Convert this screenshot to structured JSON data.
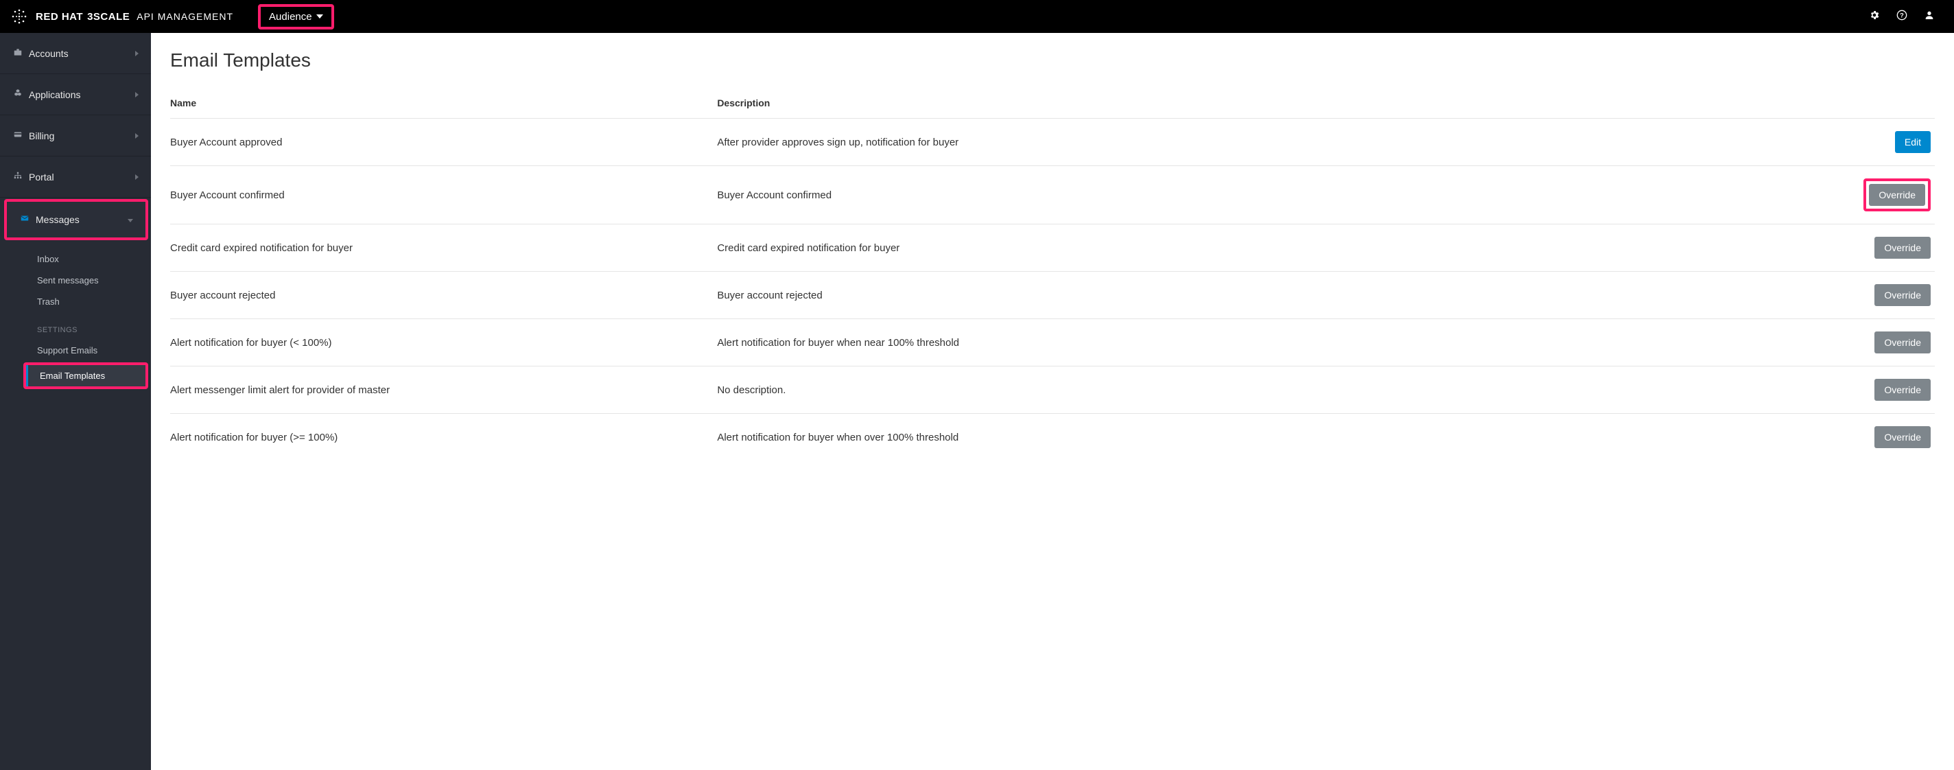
{
  "header": {
    "brand_strong": "RED HAT",
    "brand_strong2": "3SCALE",
    "product": "API MANAGEMENT",
    "context_dropdown": "Audience"
  },
  "sidebar": {
    "items": [
      {
        "icon": "briefcase",
        "label": "Accounts"
      },
      {
        "icon": "cubes",
        "label": "Applications"
      },
      {
        "icon": "card",
        "label": "Billing"
      },
      {
        "icon": "sitemap",
        "label": "Portal"
      },
      {
        "icon": "envelope",
        "label": "Messages"
      }
    ],
    "messages_sub": [
      {
        "label": "Inbox"
      },
      {
        "label": "Sent messages"
      },
      {
        "label": "Trash"
      }
    ],
    "settings_heading": "Settings",
    "settings_sub": [
      {
        "label": "Support Emails"
      },
      {
        "label": "Email Templates",
        "active": true
      }
    ]
  },
  "main": {
    "title": "Email Templates",
    "columns": {
      "name": "Name",
      "description": "Description"
    },
    "rows": [
      {
        "name": "Buyer Account approved",
        "description": "After provider approves sign up, notification for buyer",
        "action": "Edit",
        "action_style": "primary"
      },
      {
        "name": "Buyer Account confirmed",
        "description": "Buyer Account confirmed",
        "action": "Override",
        "action_style": "default",
        "highlighted": true
      },
      {
        "name": "Credit card expired notification for buyer",
        "description": "Credit card expired notification for buyer",
        "action": "Override",
        "action_style": "default"
      },
      {
        "name": "Buyer account rejected",
        "description": "Buyer account rejected",
        "action": "Override",
        "action_style": "default"
      },
      {
        "name": "Alert notification for buyer (< 100%)",
        "description": "Alert notification for buyer when near 100% threshold",
        "action": "Override",
        "action_style": "default"
      },
      {
        "name": "Alert messenger limit alert for provider of master",
        "description": "No description.",
        "action": "Override",
        "action_style": "default"
      },
      {
        "name": "Alert notification for buyer (>= 100%)",
        "description": "Alert notification for buyer when over 100% threshold",
        "action": "Override",
        "action_style": "default"
      }
    ]
  }
}
